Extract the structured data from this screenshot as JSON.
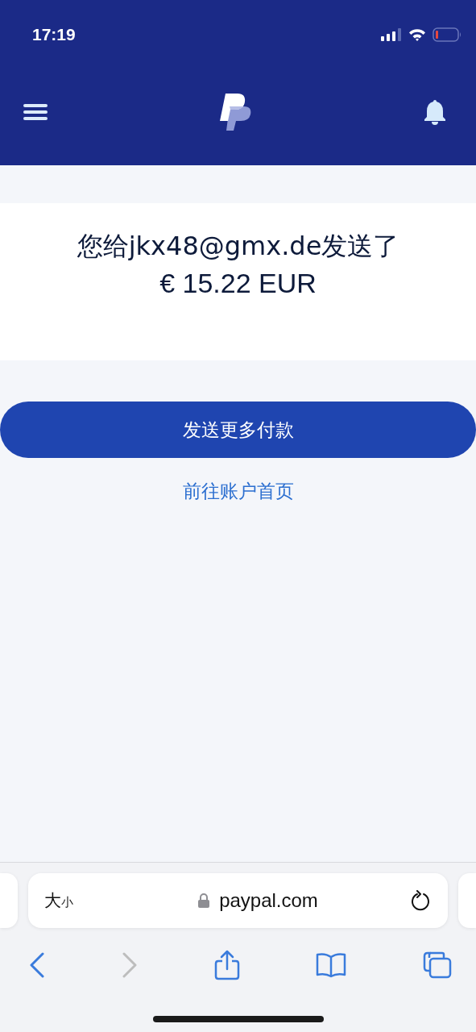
{
  "status_bar": {
    "time": "17:19"
  },
  "confirmation": {
    "line_1": "您给jkx48@gmx.de发送了",
    "amount": "€ 15.22 EUR"
  },
  "primary_button": "发送更多付款",
  "secondary_link": "前往账户首页",
  "browser": {
    "reader_button": {
      "large": "大",
      "small": "小"
    },
    "url": "paypal.com",
    "back_disabled": false,
    "forward_disabled": true
  }
}
